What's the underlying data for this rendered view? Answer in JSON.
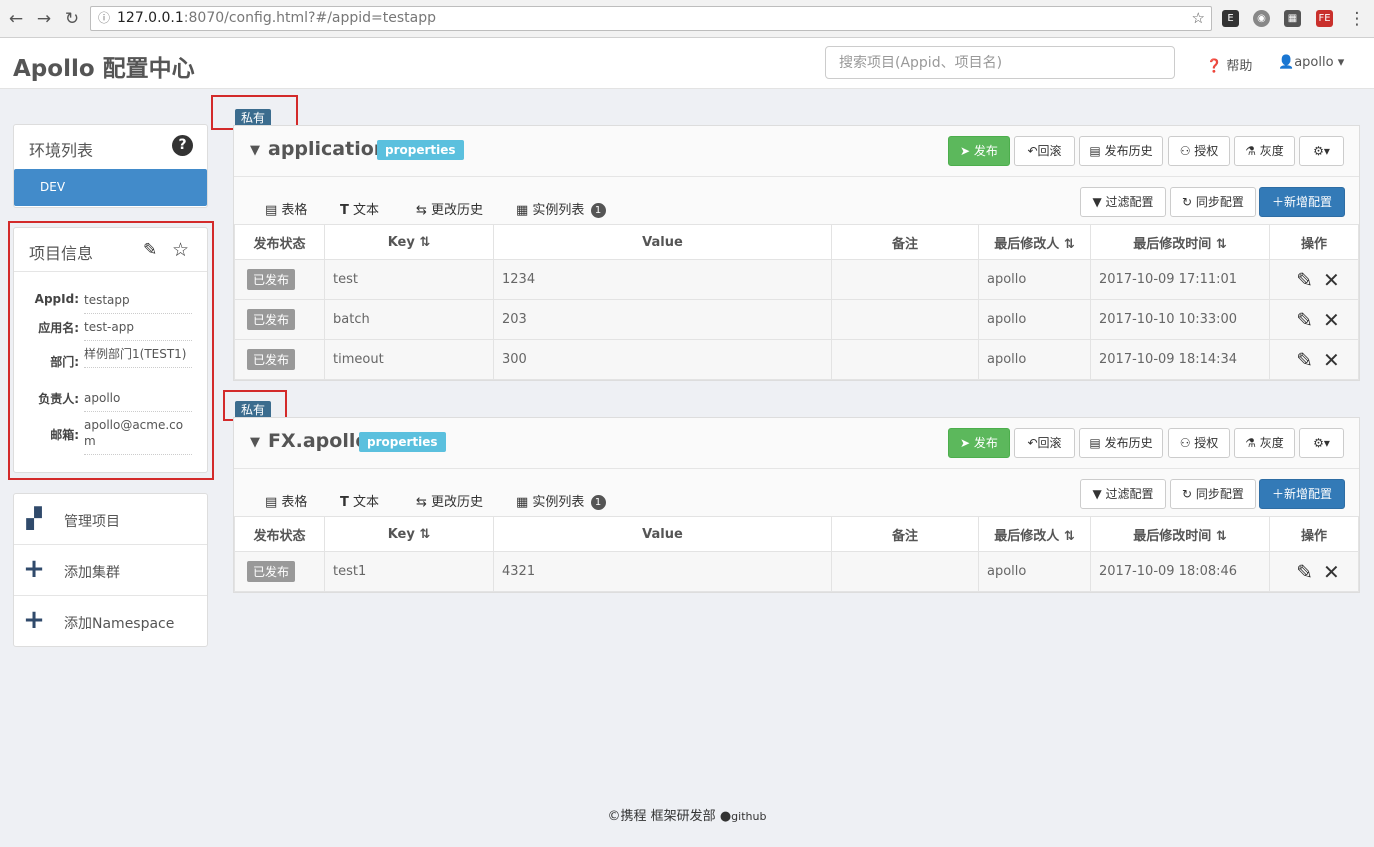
{
  "browser": {
    "url_host": "127.0.0.1",
    "url_rest": ":8070/config.html?#/appid=testapp"
  },
  "header": {
    "brand": "Apollo 配置中心",
    "search_placeholder": "搜索项目(Appid、项目名)",
    "help_label": "帮助",
    "user_label": "apollo"
  },
  "env": {
    "title": "环境列表",
    "items": [
      "DEV"
    ]
  },
  "project_info": {
    "title": "项目信息",
    "rows": [
      {
        "key": "AppId:",
        "value": "testapp"
      },
      {
        "key": "应用名:",
        "value": "test-app"
      },
      {
        "key": "部门:",
        "value": "样例部门1(TEST1)"
      },
      {
        "key": "负责人:",
        "value": "apollo"
      },
      {
        "key": "邮箱:",
        "value": "apollo@acme.com"
      }
    ]
  },
  "menu": {
    "items": [
      "管理项目",
      "添加集群",
      "添加Namespace"
    ]
  },
  "private_label": "私有",
  "toolbar": {
    "publish": "发布",
    "rollback": "回滚",
    "history": "发布历史",
    "grant": "授权",
    "gray": "灰度",
    "filter": "过滤配置",
    "sync": "同步配置",
    "add": "新增配置"
  },
  "tabs": {
    "table": "表格",
    "text": "文本",
    "history": "更改历史",
    "instances": "实例列表",
    "instances_count": "1"
  },
  "columns": {
    "status": "发布状态",
    "key": "Key",
    "value": "Value",
    "comment": "备注",
    "modifier": "最后修改人",
    "time": "最后修改时间",
    "op": "操作"
  },
  "namespaces": [
    {
      "name": "application",
      "format": "properties",
      "rows": [
        {
          "status": "已发布",
          "key": "test",
          "value": "1234",
          "comment": "",
          "modifier": "apollo",
          "time": "2017-10-09 17:11:01"
        },
        {
          "status": "已发布",
          "key": "batch",
          "value": "203",
          "comment": "",
          "modifier": "apollo",
          "time": "2017-10-10 10:33:00"
        },
        {
          "status": "已发布",
          "key": "timeout",
          "value": "300",
          "comment": "",
          "modifier": "apollo",
          "time": "2017-10-09 18:14:34"
        }
      ]
    },
    {
      "name": "FX.apollo",
      "format": "properties",
      "rows": [
        {
          "status": "已发布",
          "key": "test1",
          "value": "4321",
          "comment": "",
          "modifier": "apollo",
          "time": "2017-10-09 18:08:46"
        }
      ]
    }
  ],
  "footer": {
    "text": "©携程 框架研发部",
    "github": "github"
  },
  "colors": {
    "primary": "#337ab7",
    "success": "#5cb85c",
    "info_badge": "#5bc0de",
    "env_active": "#428bca",
    "annotation_red": "#d32a2a"
  }
}
